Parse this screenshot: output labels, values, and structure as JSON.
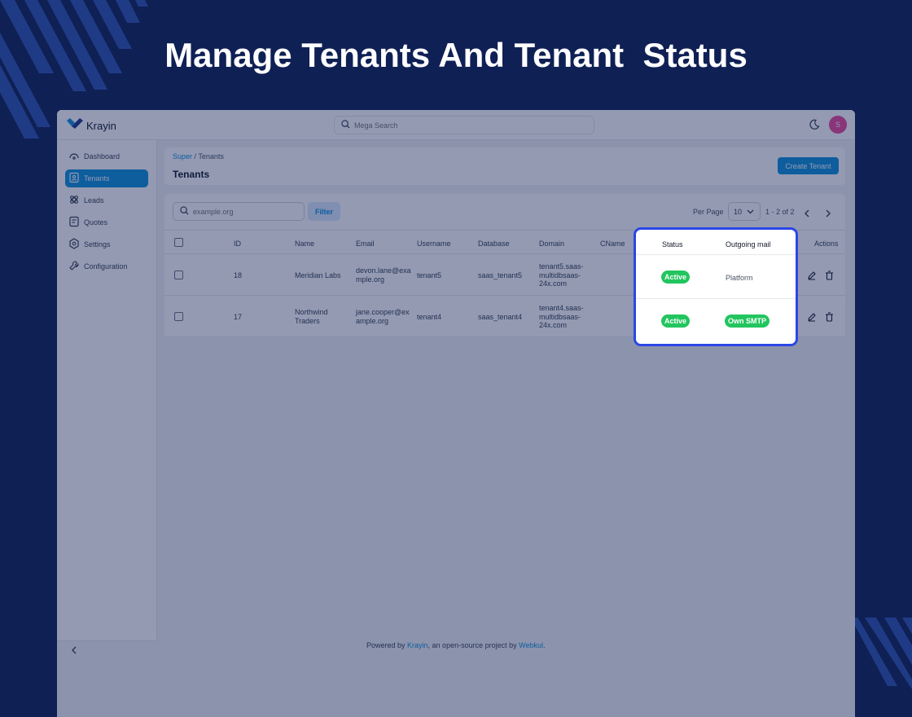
{
  "headline": "Manage Tenants And Tenant  Status",
  "colors": {
    "background": "#0f2055",
    "accent": "#0e90d9",
    "highlight": "#2b46e6",
    "badge": "#22c55e"
  },
  "topbar": {
    "logo_text": "Krayin",
    "logo_icon": "krayin-logo-icon",
    "search_placeholder": "Mega Search",
    "theme_icon": "moon-icon",
    "avatar_initial": "S"
  },
  "sidebar": {
    "items": [
      {
        "label": "Dashboard",
        "icon": "dashboard-icon",
        "active": false
      },
      {
        "label": "Tenants",
        "icon": "tenants-icon",
        "active": true
      },
      {
        "label": "Leads",
        "icon": "leads-icon",
        "active": false
      },
      {
        "label": "Quotes",
        "icon": "quotes-icon",
        "active": false
      },
      {
        "label": "Settings",
        "icon": "settings-icon",
        "active": false
      },
      {
        "label": "Configuration",
        "icon": "configuration-icon",
        "active": false
      }
    ],
    "collapse_icon": "chevron-left-icon"
  },
  "header": {
    "breadcrumb_root": "Super",
    "breadcrumb_separator": " / ",
    "breadcrumb_current": "Tenants",
    "title": "Tenants",
    "create_button": "Create Tenant"
  },
  "toolbar": {
    "search_placeholder": "example.org",
    "filter_label": "Filter",
    "per_page_label": "Per Page",
    "per_page_value": "10",
    "page_info": "1 - 2 of 2"
  },
  "table": {
    "columns": [
      "ID",
      "Name",
      "Email",
      "Username",
      "Database",
      "Domain",
      "CName",
      "Status",
      "Outgoing mail",
      "Actions"
    ],
    "rows": [
      {
        "id": "18",
        "name": [
          "Meridian Labs"
        ],
        "email": [
          "devon.lane@exa",
          "mple.org"
        ],
        "username": "tenant5",
        "database": "saas_tenant5",
        "domain": [
          "tenant5.saas-",
          "multidbsaas-",
          "24x.com"
        ],
        "status": "Active",
        "outgoing_mail": "Platform"
      },
      {
        "id": "17",
        "name": [
          "Northwind",
          "Traders"
        ],
        "email": [
          "jane.cooper@ex",
          "ample.org"
        ],
        "username": "tenant4",
        "database": "saas_tenant4",
        "domain": [
          "tenant4.saas-",
          "multidbsaas-",
          "24x.com"
        ],
        "status": "Active",
        "outgoing_mail": "Own SMTP"
      }
    ]
  },
  "footer": {
    "prefix": "Powered by ",
    "brand": "Krayin",
    "middle": ", an open-source project by ",
    "company": "Webkul",
    "suffix": "."
  }
}
